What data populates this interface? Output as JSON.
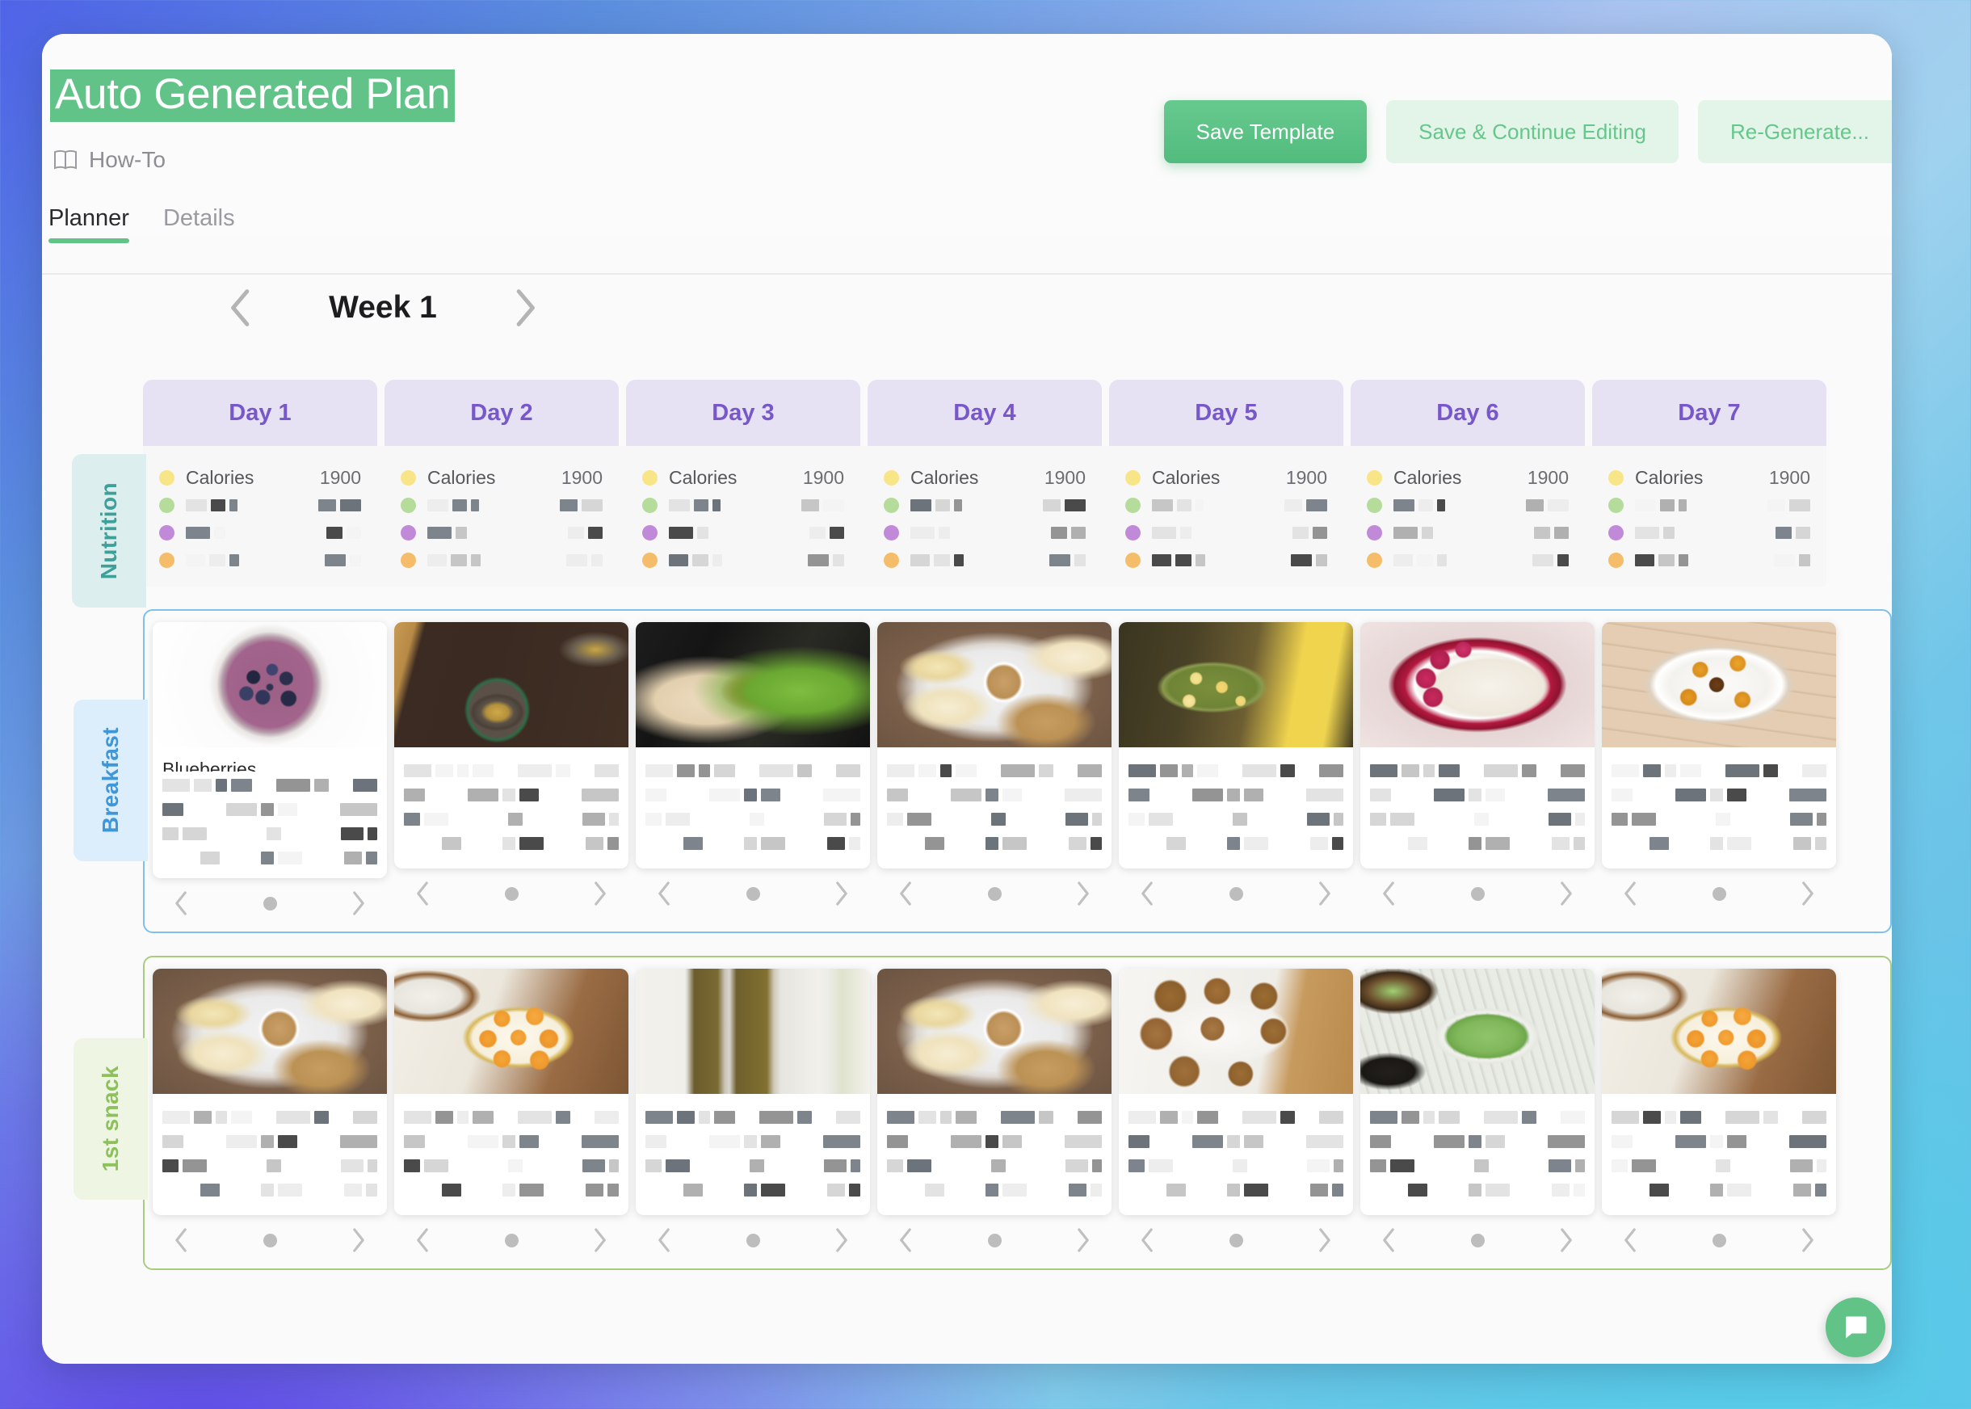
{
  "header": {
    "plan_title": "Auto Generated Plan",
    "howto_label": "How-To",
    "howto_icon": "book-icon",
    "buttons": {
      "save_template": "Save Template",
      "save_continue": "Save & Continue Editing",
      "regenerate": "Re-Generate..."
    },
    "tabs": [
      {
        "label": "Planner",
        "active": true
      },
      {
        "label": "Details",
        "active": false
      }
    ]
  },
  "planner": {
    "week_label": "Week 1",
    "prev_week_icon": "chevron-left-icon",
    "next_week_icon": "chevron-right-icon",
    "day_headers": [
      "Day 1",
      "Day 2",
      "Day 3",
      "Day 4",
      "Day 5",
      "Day 6",
      "Day 7"
    ],
    "row_labels": {
      "nutrition": "Nutrition",
      "breakfast": "Breakfast",
      "snack": "1st snack"
    },
    "nutrition": {
      "colors": {
        "calories": "#f8e588",
        "protein": "#b5dc9b",
        "carbs": "#c08ad8",
        "fat": "#f5bc6a"
      },
      "days": [
        {
          "calories_label": "Calories",
          "calories_value": "1900"
        },
        {
          "calories_label": "Calories",
          "calories_value": "1900"
        },
        {
          "calories_label": "Calories",
          "calories_value": "1900"
        },
        {
          "calories_label": "Calories",
          "calories_value": "1900"
        },
        {
          "calories_label": "Calories",
          "calories_value": "1900"
        },
        {
          "calories_label": "Calories",
          "calories_value": "1900"
        },
        {
          "calories_label": "Calories",
          "calories_value": "1900"
        }
      ]
    },
    "card_nav": {
      "prev_icon": "chevron-left-icon",
      "next_icon": "chevron-right-icon",
      "page_dot": "page-indicator-dot"
    },
    "breakfast_cards": [
      {
        "image_name": "blueberry-smoothie-bowl",
        "title": "Blueberries"
      },
      {
        "image_name": "chia-pudding-jars",
        "title": ""
      },
      {
        "image_name": "pita-wrap-salad",
        "title": ""
      },
      {
        "image_name": "apple-slices-nut-butter",
        "title": ""
      },
      {
        "image_name": "green-smoothie-jar",
        "title": ""
      },
      {
        "image_name": "cottage-cheese-raspberries",
        "title": ""
      },
      {
        "image_name": "shrimp-rice-bowl",
        "title": ""
      }
    ],
    "snack_cards": [
      {
        "image_name": "apple-slices-nut-butter",
        "title": ""
      },
      {
        "image_name": "coconut-energy-balls",
        "title": ""
      },
      {
        "image_name": "pistachio-nut-bars",
        "title": ""
      },
      {
        "image_name": "apple-slices-nut-butter",
        "title": ""
      },
      {
        "image_name": "oat-energy-balls",
        "title": ""
      },
      {
        "image_name": "guacamole-bowl",
        "title": ""
      },
      {
        "image_name": "coconut-energy-balls",
        "title": ""
      }
    ]
  },
  "chat_widget": {
    "icon": "chat-bubble-icon",
    "color": "#62c389"
  },
  "theme": {
    "accent_green": "#62c389",
    "day_header_bg": "#e6e2f3",
    "day_header_text": "#7757c9",
    "nutrition_tab": "#dcefee",
    "breakfast_tab": "#dceefb",
    "snack_tab": "#eef6e3"
  }
}
